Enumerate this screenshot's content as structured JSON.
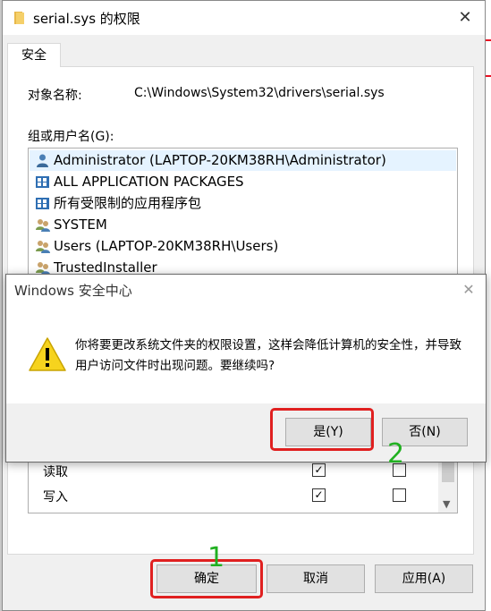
{
  "window": {
    "title": "serial.sys 的权限",
    "close_glyph": "✕"
  },
  "tabs": [
    {
      "label": "安全"
    }
  ],
  "object": {
    "label": "对象名称:",
    "value": "C:\\Windows\\System32\\drivers\\serial.sys"
  },
  "groups": {
    "label": "组或用户名(G):",
    "items": [
      {
        "label": "Administrator (LAPTOP-20KM38RH\\Administrator)",
        "icon": "user-icon"
      },
      {
        "label": "ALL APPLICATION PACKAGES",
        "icon": "package-icon"
      },
      {
        "label": "所有受限制的应用程序包",
        "icon": "package-icon"
      },
      {
        "label": "SYSTEM",
        "icon": "users-icon"
      },
      {
        "label": "Users (LAPTOP-20KM38RH\\Users)",
        "icon": "users-icon"
      },
      {
        "label": "TrustedInstaller",
        "icon": "users-icon"
      }
    ]
  },
  "permissions": {
    "rows": [
      {
        "name": "读取",
        "allow": true,
        "deny": false
      },
      {
        "name": "写入",
        "allow": true,
        "deny": false
      }
    ]
  },
  "buttons": {
    "ok": "确定",
    "cancel": "取消",
    "apply": "应用(A)"
  },
  "dialog": {
    "title": "Windows 安全中心",
    "close_glyph": "✕",
    "message": "你将要更改系统文件夹的权限设置，这样会降低计算机的安全性，并导致用户访问文件时出现问题。要继续吗?",
    "yes": "是(Y)",
    "no": "否(N)"
  },
  "annotations": {
    "step1": "1",
    "step2": "2",
    "highlight_color": "#e02020",
    "number_color": "#20b020"
  },
  "colors": {
    "selected_row": "#e5f3ff",
    "warning_yellow": "#f6d31e"
  }
}
